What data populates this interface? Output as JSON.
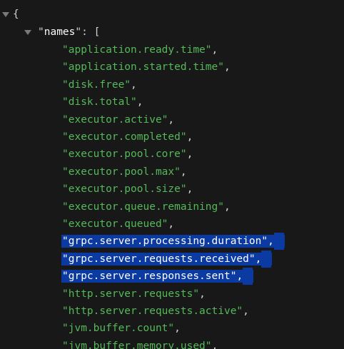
{
  "viewer": {
    "open_brace": "{",
    "names_key": "names",
    "colon": ":",
    "open_bracket": "[",
    "comma": ","
  },
  "names": [
    "\"application.ready.time\"",
    "\"application.started.time\"",
    "\"disk.free\"",
    "\"disk.total\"",
    "\"executor.active\"",
    "\"executor.completed\"",
    "\"executor.pool.core\"",
    "\"executor.pool.max\"",
    "\"executor.pool.size\"",
    "\"executor.queue.remaining\"",
    "\"executor.queued\"",
    "\"grpc.server.processing.duration\"",
    "\"grpc.server.requests.received\"",
    "\"grpc.server.responses.sent\"",
    "\"http.server.requests\"",
    "\"http.server.requests.active\"",
    "\"jvm.buffer.count\"",
    "\"jvm.buffer.memory.used\""
  ],
  "selected_items": [
    "\"grpc.server.processing.duration\"",
    "\"grpc.server.requests.received\"",
    "\"grpc.server.responses.sent\""
  ]
}
